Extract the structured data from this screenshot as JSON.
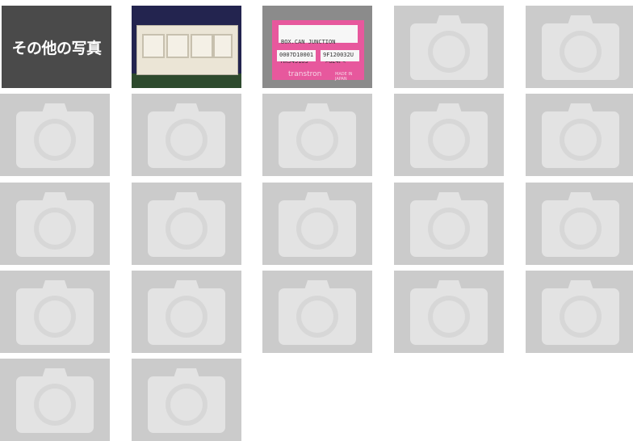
{
  "gallery": {
    "other_photos_label": "その他の写真",
    "label_photo": {
      "line1": "BOX.CAN JUNCTION",
      "line2": "MK543183     >GE4F<",
      "part_no": "0007D10001",
      "lot_no": "9F120032U",
      "brand": "transtron",
      "made_in": "MADE IN JAPAN"
    },
    "placeholder_icon": "camera-icon",
    "placeholder_count": 19
  },
  "colors": {
    "placeholder_bg": "#cbcbcb",
    "placeholder_icon": "#e3e3e3",
    "other_tile_bg": "#4a4a4a"
  }
}
